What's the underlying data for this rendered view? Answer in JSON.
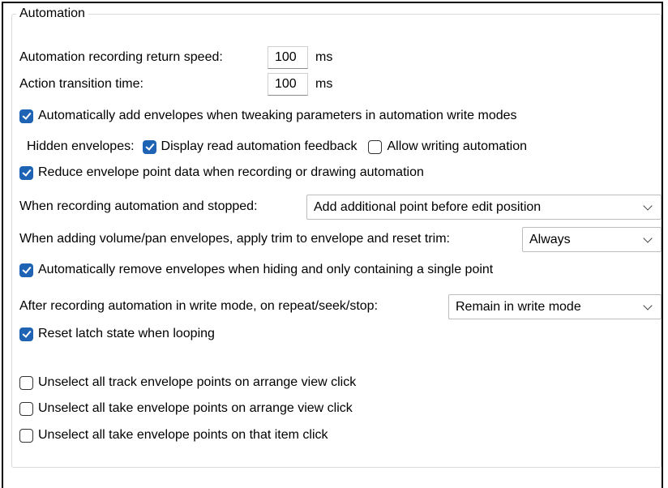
{
  "group_title": "Automation",
  "return_speed": {
    "label": "Automation recording return speed:",
    "value": "100",
    "unit": "ms"
  },
  "transition": {
    "label": "Action transition time:",
    "value": "100",
    "unit": "ms"
  },
  "auto_add_envelopes": {
    "label": "Automatically add envelopes when tweaking parameters in automation write modes",
    "checked": true
  },
  "hidden_envelopes": {
    "label": "Hidden envelopes:",
    "display_feedback": {
      "label": "Display read automation feedback",
      "checked": true
    },
    "allow_writing": {
      "label": "Allow writing automation",
      "checked": false
    }
  },
  "reduce_points": {
    "label": "Reduce envelope point data when recording or drawing automation",
    "checked": true
  },
  "stopped": {
    "label": "When recording automation and stopped:",
    "selected": "Add additional point before edit position"
  },
  "trim": {
    "label": "When adding volume/pan envelopes, apply trim to envelope and reset trim:",
    "selected": "Always"
  },
  "auto_remove": {
    "label": "Automatically remove envelopes when hiding and only containing a single point",
    "checked": true
  },
  "after_write": {
    "label": "After recording automation in write mode, on repeat/seek/stop:",
    "selected": "Remain in write mode"
  },
  "reset_latch": {
    "label": "Reset latch state when looping",
    "checked": true
  },
  "unselect_track": {
    "label": "Unselect all track envelope points on arrange view click",
    "checked": false
  },
  "unselect_take": {
    "label": "Unselect all take envelope points on arrange view click",
    "checked": false
  },
  "unselect_item": {
    "label": "Unselect all take envelope points on that item click",
    "checked": false
  },
  "colors": {
    "accent": "#1e63b4"
  }
}
